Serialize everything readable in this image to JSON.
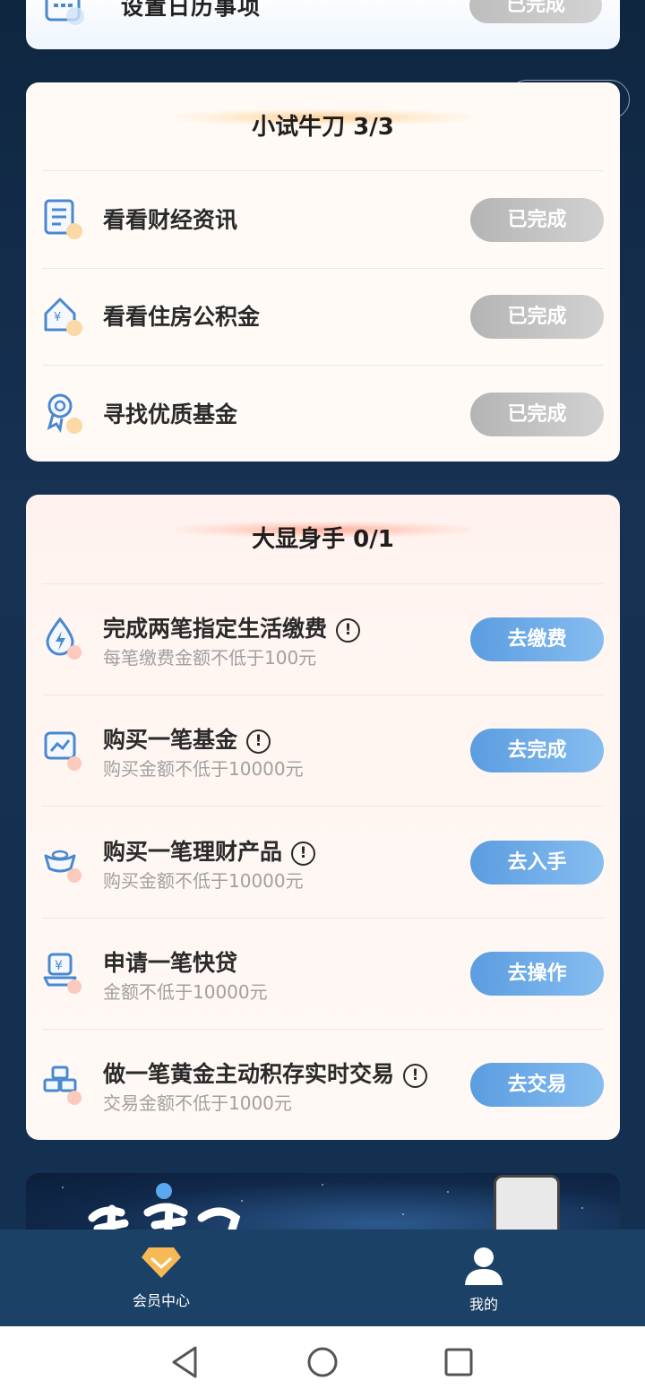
{
  "top_card": {
    "title": "设置日历事项",
    "button": "已完成"
  },
  "section1": {
    "title": "小试牛刀 3/3",
    "tasks": [
      {
        "title": "看看财经资讯",
        "button": "已完成",
        "icon": "news-document-icon"
      },
      {
        "title": "看看住房公积金",
        "button": "已完成",
        "icon": "house-yuan-icon"
      },
      {
        "title": "寻找优质基金",
        "button": "已完成",
        "icon": "award-medal-icon"
      }
    ]
  },
  "section2": {
    "title": "大显身手 0/1",
    "tasks": [
      {
        "title": "完成两笔指定生活缴费",
        "subtitle": "每笔缴费金额不低于100元",
        "button": "去缴费",
        "info": "!",
        "icon": "water-bolt-icon"
      },
      {
        "title": "购买一笔基金",
        "subtitle": "购买金额不低于10000元",
        "button": "去完成",
        "info": "!",
        "icon": "chart-trend-icon"
      },
      {
        "title": "购买一笔理财产品",
        "subtitle": "购买金额不低于10000元",
        "button": "去入手",
        "info": "!",
        "icon": "gold-ingot-icon"
      },
      {
        "title": "申请一笔快贷",
        "subtitle": "金额不低于10000元",
        "button": "去操作",
        "icon": "loan-yuan-icon"
      },
      {
        "title": "做一笔黄金主动积存实时交易",
        "subtitle": "交易金额不低于1000元",
        "button": "去交易",
        "info": "!",
        "icon": "gold-bars-icon"
      }
    ]
  },
  "tabbar": {
    "items": [
      {
        "label": "会员中心",
        "icon": "diamond-icon"
      },
      {
        "label": "我的",
        "icon": "user-icon"
      }
    ]
  },
  "colors": {
    "background": "#163152",
    "button_done": "#bdbdbd",
    "button_go": "#5b9de0",
    "tabbar": "#1c4166"
  }
}
